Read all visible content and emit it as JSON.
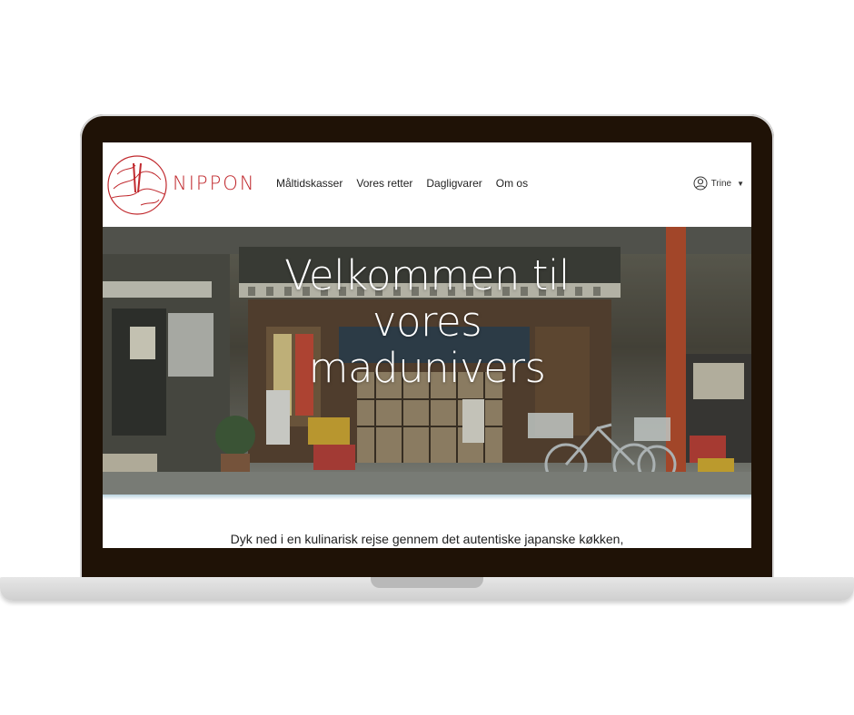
{
  "brand": {
    "name": "NIPPON",
    "accent_color": "#c0282d"
  },
  "nav": {
    "links": [
      "Måltidskasser",
      "Vores retter",
      "Dagligvarer",
      "Om os"
    ]
  },
  "user": {
    "name": "Trine",
    "icon": "user-circle-icon",
    "dropdown_icon": "caret-down-icon"
  },
  "hero": {
    "title_lines": [
      "Velkommen til",
      "vores",
      "madunivers"
    ],
    "image": "japanese-storefront-photo"
  },
  "intro": {
    "text": "Dyk ned i en kulinarisk rejse gennem det autentiske japanske køkken,"
  }
}
